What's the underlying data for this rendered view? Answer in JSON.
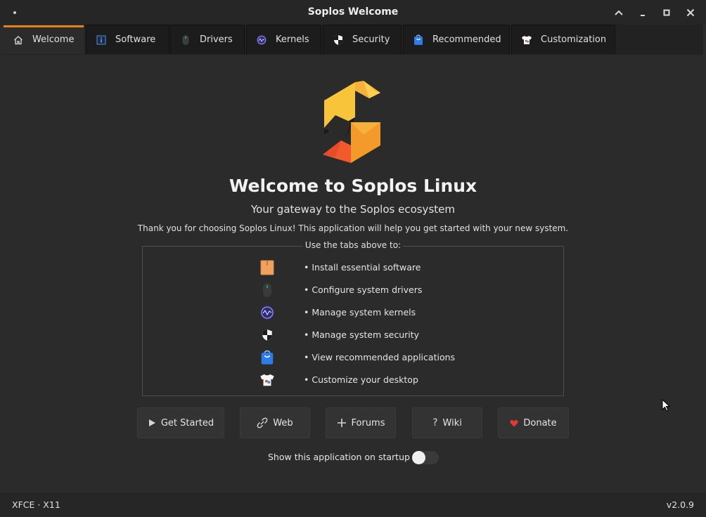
{
  "window": {
    "title": "Soplos Welcome"
  },
  "tabs": [
    {
      "label": "Welcome",
      "icon": "home-icon",
      "active": true
    },
    {
      "label": "Software",
      "icon": "info-icon",
      "active": false
    },
    {
      "label": "Drivers",
      "icon": "mouse-icon",
      "active": false
    },
    {
      "label": "Kernels",
      "icon": "kernel-icon",
      "active": false
    },
    {
      "label": "Security",
      "icon": "shield-icon",
      "active": false
    },
    {
      "label": "Recommended",
      "icon": "store-bag-icon",
      "active": false
    },
    {
      "label": "Customization",
      "icon": "tshirt-icon",
      "active": false
    }
  ],
  "main": {
    "heading": "Welcome to Soplos Linux",
    "subheading": "Your gateway to the Soplos ecosystem",
    "thanks": "Thank you for choosing Soplos Linux! This application will help you get started with your new system.",
    "frame_title": "Use the tabs above to:",
    "features": [
      {
        "text": "• Install essential software",
        "icon": "package-icon"
      },
      {
        "text": "• Configure system drivers",
        "icon": "mouse-icon"
      },
      {
        "text": "• Manage system kernels",
        "icon": "kernel-icon"
      },
      {
        "text": "• Manage system security",
        "icon": "shield-icon"
      },
      {
        "text": "• View recommended applications",
        "icon": "store-bag-icon"
      },
      {
        "text": "• Customize your desktop",
        "icon": "tshirt-icon"
      }
    ]
  },
  "buttons": {
    "get_started": "Get Started",
    "web": "Web",
    "forums": "Forums",
    "wiki": "Wiki",
    "donate": "Donate"
  },
  "startup": {
    "label": "Show this application on startup",
    "enabled": false
  },
  "status": {
    "session": "XFCE · X11",
    "version": "v2.0.9"
  },
  "colors": {
    "accent": "#e8801a",
    "background": "#2b2b2b",
    "donate_heart": "#e53935"
  }
}
